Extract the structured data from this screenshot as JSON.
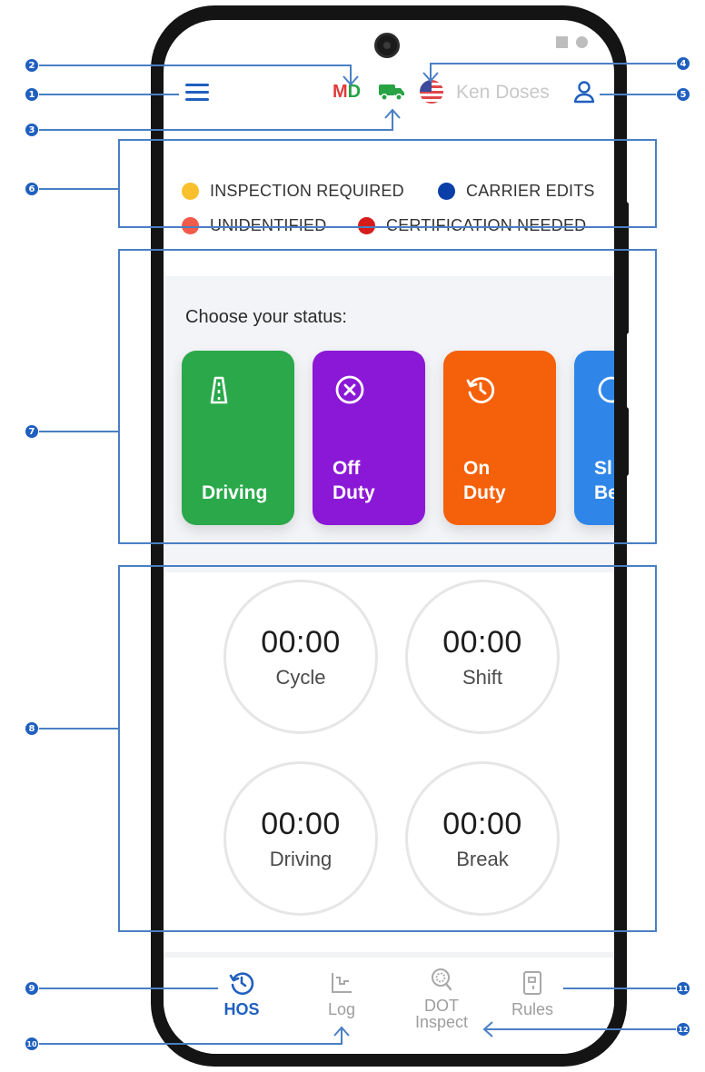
{
  "header": {
    "state_code_first": "M",
    "state_code_second": "D",
    "truck_icon": "truck-icon",
    "flag_icon": "us-flag-icon",
    "user_name": "Ken Doses",
    "menu_icon": "hamburger-menu-icon",
    "profile_icon": "user-profile-icon"
  },
  "legend": [
    {
      "label": "INSPECTION REQUIRED",
      "color": "#f7c02c"
    },
    {
      "label": "CARRIER EDITS",
      "color": "#0a3ea8"
    },
    {
      "label": "UNIDENTIFIED",
      "color": "#f25a4a"
    },
    {
      "label": "CERTIFICATION NEEDED",
      "color": "#d81b1b"
    }
  ],
  "status": {
    "title": "Choose your status:",
    "cards": [
      {
        "line1": "",
        "line2": "Driving",
        "color": "#2aa84a",
        "icon": "road-icon"
      },
      {
        "line1": "Off",
        "line2": "Duty",
        "color": "#8b18d6",
        "icon": "close-circle-icon"
      },
      {
        "line1": "On",
        "line2": "Duty",
        "color": "#f5600a",
        "icon": "history-clock-icon"
      },
      {
        "line1": "Sl",
        "line2": "Be",
        "color": "#2f86e8",
        "icon": "circle-icon"
      }
    ]
  },
  "timers": [
    {
      "value": "00:00",
      "label": "Cycle"
    },
    {
      "value": "00:00",
      "label": "Shift"
    },
    {
      "value": "00:00",
      "label": "Driving"
    },
    {
      "value": "00:00",
      "label": "Break"
    }
  ],
  "nav": [
    {
      "line1": "HOS",
      "line2": "",
      "icon": "history-clock-icon",
      "active": true
    },
    {
      "line1": "Log",
      "line2": "",
      "icon": "log-chart-icon",
      "active": false
    },
    {
      "line1": "DOT",
      "line2": "Inspect",
      "icon": "inspect-magnifier-icon",
      "active": false
    },
    {
      "line1": "Rules",
      "line2": "",
      "icon": "rules-document-icon",
      "active": false
    }
  ],
  "callouts": [
    "1",
    "2",
    "3",
    "4",
    "5",
    "6",
    "7",
    "8",
    "9",
    "10",
    "11",
    "12"
  ],
  "colors": {
    "accent": "#1f5fbf",
    "annotation": "#4a7fc4"
  }
}
